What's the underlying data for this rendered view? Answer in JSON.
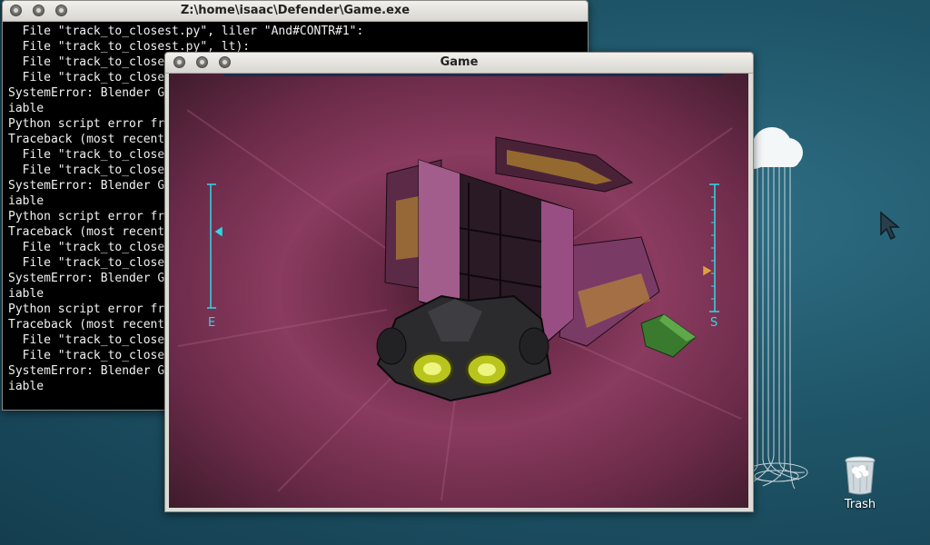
{
  "console_window": {
    "title": "Z:\\home\\isaac\\Defender\\Game.exe",
    "lines": [
      "  File \"track_to_closest.py\", liler \"And#CONTR#1\":",
      "  File \"track_to_closest.py\", lt):",
      "  File \"track_to_closest",
      "  File \"track_to_close",
      "SystemError: Blender G",
      "iable",
      "Python script error fr",
      "Traceback (most recent",
      "  File \"track_to_close",
      "  File \"track_to_close",
      "SystemError: Blender G",
      "iable",
      "Python script error fr",
      "Traceback (most recent",
      "  File \"track_to_close",
      "  File \"track_to_close",
      "SystemError: Blender G",
      "iable",
      "Python script error fr",
      "Traceback (most recent",
      "  File \"track_to_close",
      "  File \"track_to_close",
      "SystemError: Blender G",
      "iable"
    ]
  },
  "game_window": {
    "title": "Game",
    "hud": {
      "left_label": "E",
      "right_label": "S",
      "accent": "#2fd8e8"
    }
  },
  "desktop": {
    "trash_label": "Trash"
  },
  "colors": {
    "desktop_bg": "#1f5568",
    "console_bg": "#000000",
    "console_text": "#f2f2f2",
    "tunnel": "#8a3b5f"
  }
}
